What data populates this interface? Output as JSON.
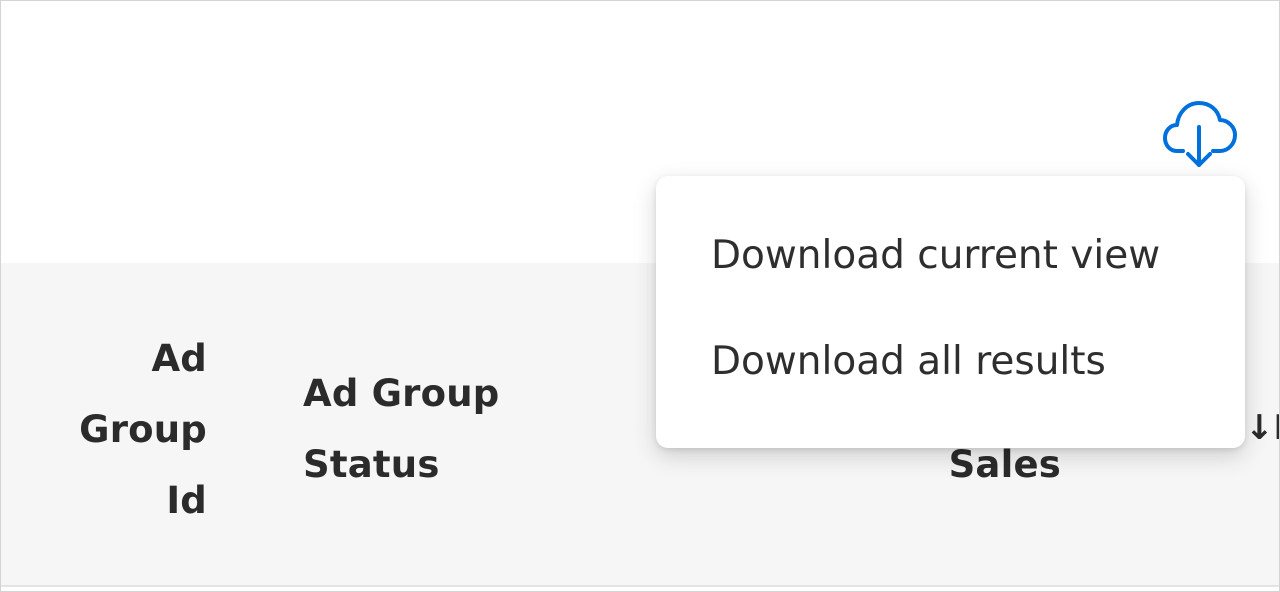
{
  "toolbar": {
    "download_icon": "cloud-download-icon",
    "accent_color": "#0071dc"
  },
  "download_menu": {
    "items": [
      {
        "label": "Download current view"
      },
      {
        "label": "Download all results"
      }
    ]
  },
  "table": {
    "columns": [
      {
        "label_lines": [
          "Ad",
          "Group",
          "Id"
        ]
      },
      {
        "label_lines": [
          "Ad Group",
          "Status"
        ]
      },
      {
        "label_lines": [
          "Sales"
        ]
      }
    ],
    "sort_indicator": "↓I"
  }
}
